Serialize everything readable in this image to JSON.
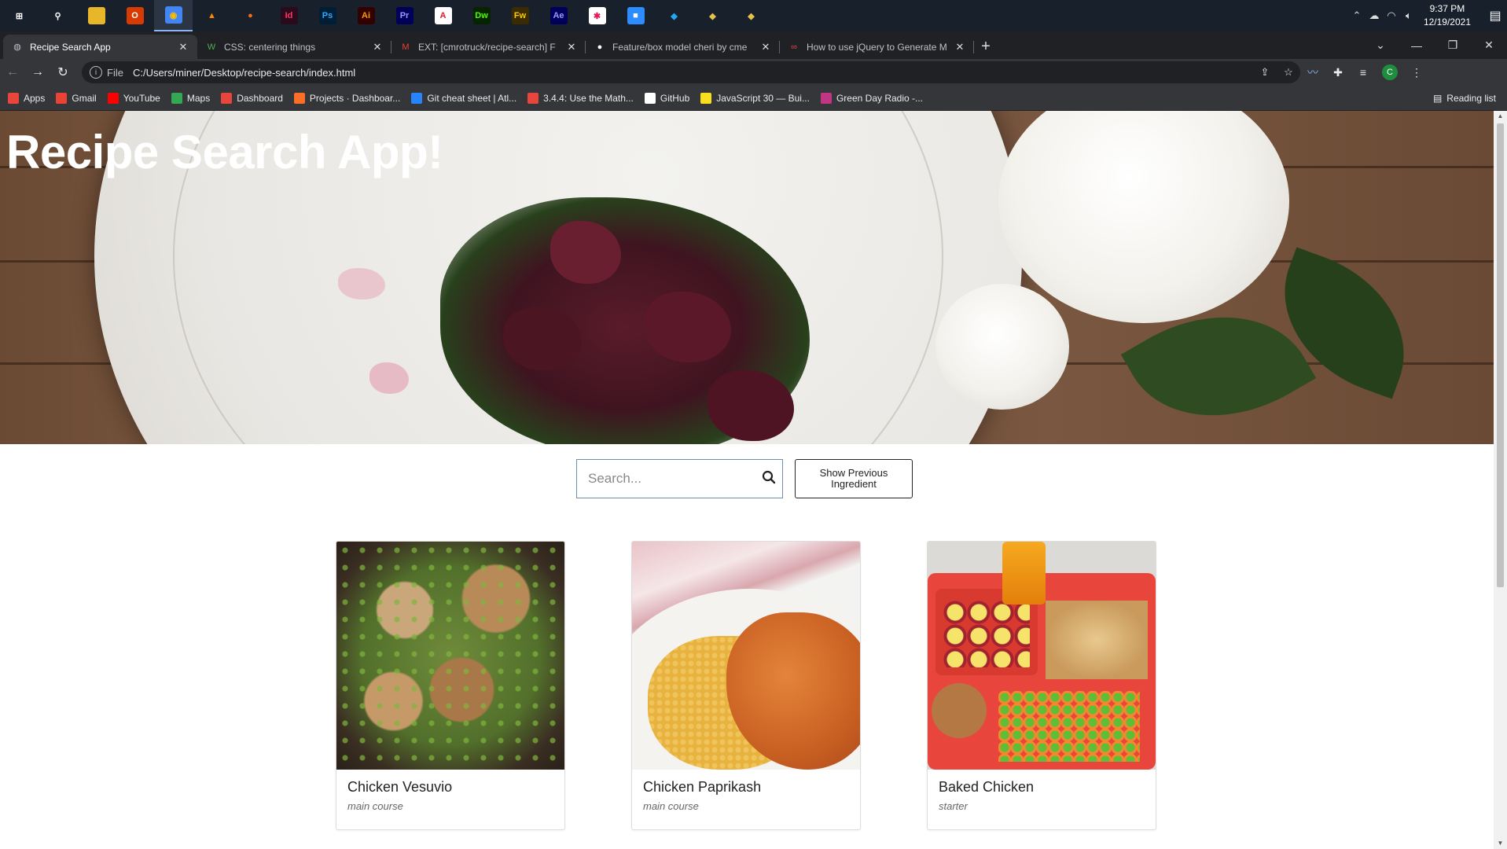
{
  "taskbar": {
    "apps": [
      {
        "name": "windows-start",
        "glyph": "⊞",
        "bg": "transparent",
        "fg": "#ffffff"
      },
      {
        "name": "search",
        "glyph": "⚲",
        "bg": "transparent",
        "fg": "#ffffff"
      },
      {
        "name": "file-explorer",
        "glyph": "▬",
        "bg": "#e8b729",
        "fg": "#e8b729"
      },
      {
        "name": "office",
        "glyph": "O",
        "bg": "#d83b01",
        "fg": "#ffffff"
      },
      {
        "name": "chrome",
        "glyph": "◉",
        "bg": "#4285f4",
        "fg": "#fbbc05",
        "active": true
      },
      {
        "name": "vlc",
        "glyph": "▲",
        "bg": "transparent",
        "fg": "#ff8800"
      },
      {
        "name": "app-orange",
        "glyph": "●",
        "bg": "transparent",
        "fg": "#f26b1d"
      },
      {
        "name": "indesign",
        "glyph": "Id",
        "bg": "#2b0a1c",
        "fg": "#ff3366"
      },
      {
        "name": "photoshop",
        "glyph": "Ps",
        "bg": "#001e36",
        "fg": "#31a8ff"
      },
      {
        "name": "illustrator",
        "glyph": "Ai",
        "bg": "#330000",
        "fg": "#ff9a00"
      },
      {
        "name": "premiere",
        "glyph": "Pr",
        "bg": "#00005b",
        "fg": "#9999ff"
      },
      {
        "name": "acrobat",
        "glyph": "A",
        "bg": "#ffffff",
        "fg": "#e51c23"
      },
      {
        "name": "dreamweaver",
        "glyph": "Dw",
        "bg": "#072401",
        "fg": "#4aff00"
      },
      {
        "name": "fireworks",
        "glyph": "Fw",
        "bg": "#3a2b00",
        "fg": "#ffcc00"
      },
      {
        "name": "after-effects",
        "glyph": "Ae",
        "bg": "#00005b",
        "fg": "#9999ff"
      },
      {
        "name": "slack",
        "glyph": "✱",
        "bg": "#ffffff",
        "fg": "#e01e5a"
      },
      {
        "name": "zoom",
        "glyph": "■",
        "bg": "#2d8cff",
        "fg": "#ffffff"
      },
      {
        "name": "vscode",
        "glyph": "◆",
        "bg": "transparent",
        "fg": "#23a9f2"
      },
      {
        "name": "git-kraken-1",
        "glyph": "◆",
        "bg": "transparent",
        "fg": "#e6c04a"
      },
      {
        "name": "git-kraken-2",
        "glyph": "◆",
        "bg": "transparent",
        "fg": "#e6c04a"
      }
    ],
    "time": "9:37 PM",
    "date": "12/19/2021"
  },
  "tabs": [
    {
      "label": "Recipe Search App",
      "favicon": "globe",
      "active": true
    },
    {
      "label": "CSS: centering things",
      "favicon": "W3"
    },
    {
      "label": "EXT: [cmrotruck/recipe-search] F",
      "favicon": "M"
    },
    {
      "label": "Feature/box model cheri by cme",
      "favicon": "github"
    },
    {
      "label": "How to use jQuery to Generate M",
      "favicon": "∞"
    }
  ],
  "address": {
    "scheme": "File",
    "url": "C:/Users/miner/Desktop/recipe-search/index.html"
  },
  "bookmarks": [
    {
      "label": "Apps",
      "color": "#e8453c"
    },
    {
      "label": "Gmail",
      "color": "#ea4335"
    },
    {
      "label": "YouTube",
      "color": "#ff0000"
    },
    {
      "label": "Maps",
      "color": "#34a853"
    },
    {
      "label": "Dashboard",
      "color": "#e8453c"
    },
    {
      "label": "Projects · Dashboar...",
      "color": "#fc6d26"
    },
    {
      "label": "Git cheat sheet | Atl...",
      "color": "#2684ff"
    },
    {
      "label": "3.4.4: Use the Math...",
      "color": "#e8453c"
    },
    {
      "label": "GitHub",
      "color": "#ffffff"
    },
    {
      "label": "JavaScript 30 — Bui...",
      "color": "#f7df1e"
    },
    {
      "label": "Green Day Radio -...",
      "color": "#c13584"
    }
  ],
  "reading_list": "Reading list",
  "page": {
    "title": "Recipe Search App!",
    "search_placeholder": "Search...",
    "prev_button": "Show Previous Ingredient",
    "recipes": [
      {
        "title": "Chicken Vesuvio",
        "category": "main course"
      },
      {
        "title": "Chicken Paprikash",
        "category": "main course"
      },
      {
        "title": "Baked Chicken",
        "category": "starter"
      }
    ]
  },
  "colors": {
    "accent": "#8ab4f8",
    "search_border": "#6c8fb5"
  }
}
